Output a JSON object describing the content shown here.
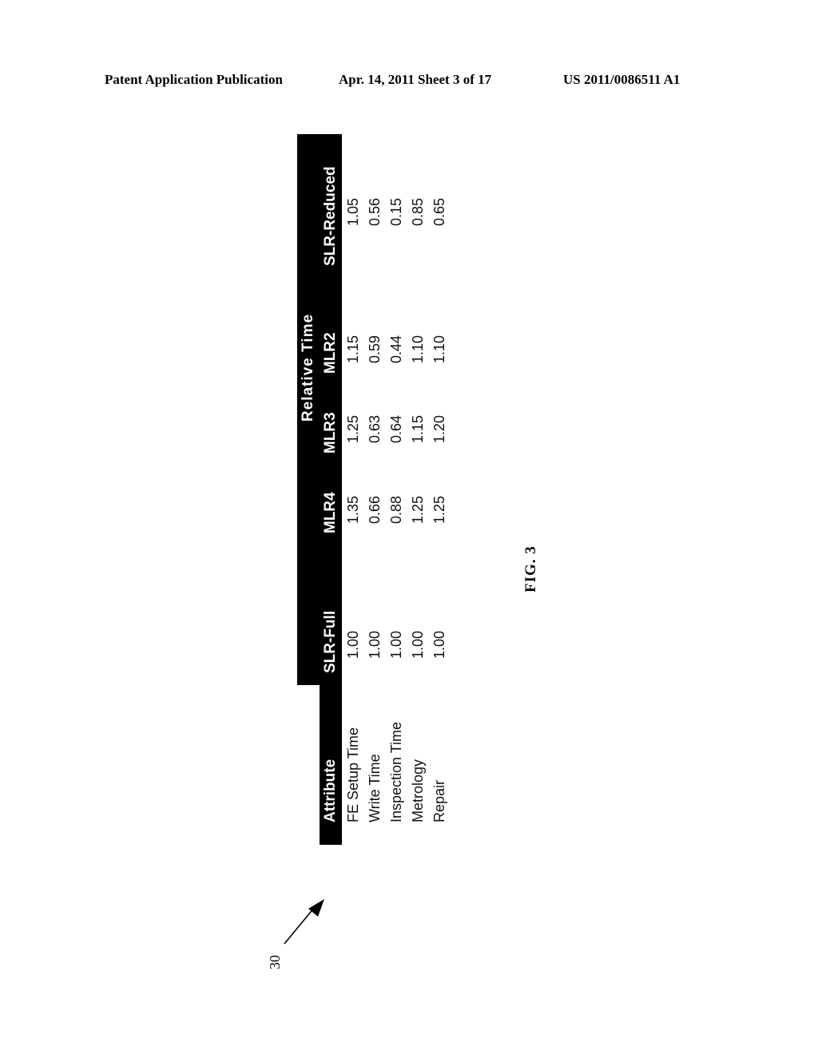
{
  "header": {
    "publication": "Patent Application Publication",
    "date_sheet": "Apr. 14, 2011  Sheet 3 of 17",
    "patent_number": "US 2011/0086511 A1"
  },
  "table": {
    "group_header": "Relative Time",
    "attribute_header": "Attribute",
    "columns": [
      "SLR-Full",
      "MLR4",
      "MLR3",
      "MLR2",
      "SLR-Reduced"
    ],
    "rows": [
      {
        "attribute": "FE Setup Time",
        "values": [
          "1.00",
          "1.35",
          "1.25",
          "1.15",
          "1.05"
        ]
      },
      {
        "attribute": "Write Time",
        "values": [
          "1.00",
          "0.66",
          "0.63",
          "0.59",
          "0.56"
        ]
      },
      {
        "attribute": "Inspection Time",
        "values": [
          "1.00",
          "0.88",
          "0.64",
          "0.44",
          "0.15"
        ]
      },
      {
        "attribute": "Metrology",
        "values": [
          "1.00",
          "1.25",
          "1.15",
          "1.10",
          "0.85"
        ]
      },
      {
        "attribute": "Repair",
        "values": [
          "1.00",
          "1.25",
          "1.20",
          "1.10",
          "0.65"
        ]
      }
    ]
  },
  "figure": {
    "label": "FIG. 3",
    "reference_numeral": "30"
  }
}
